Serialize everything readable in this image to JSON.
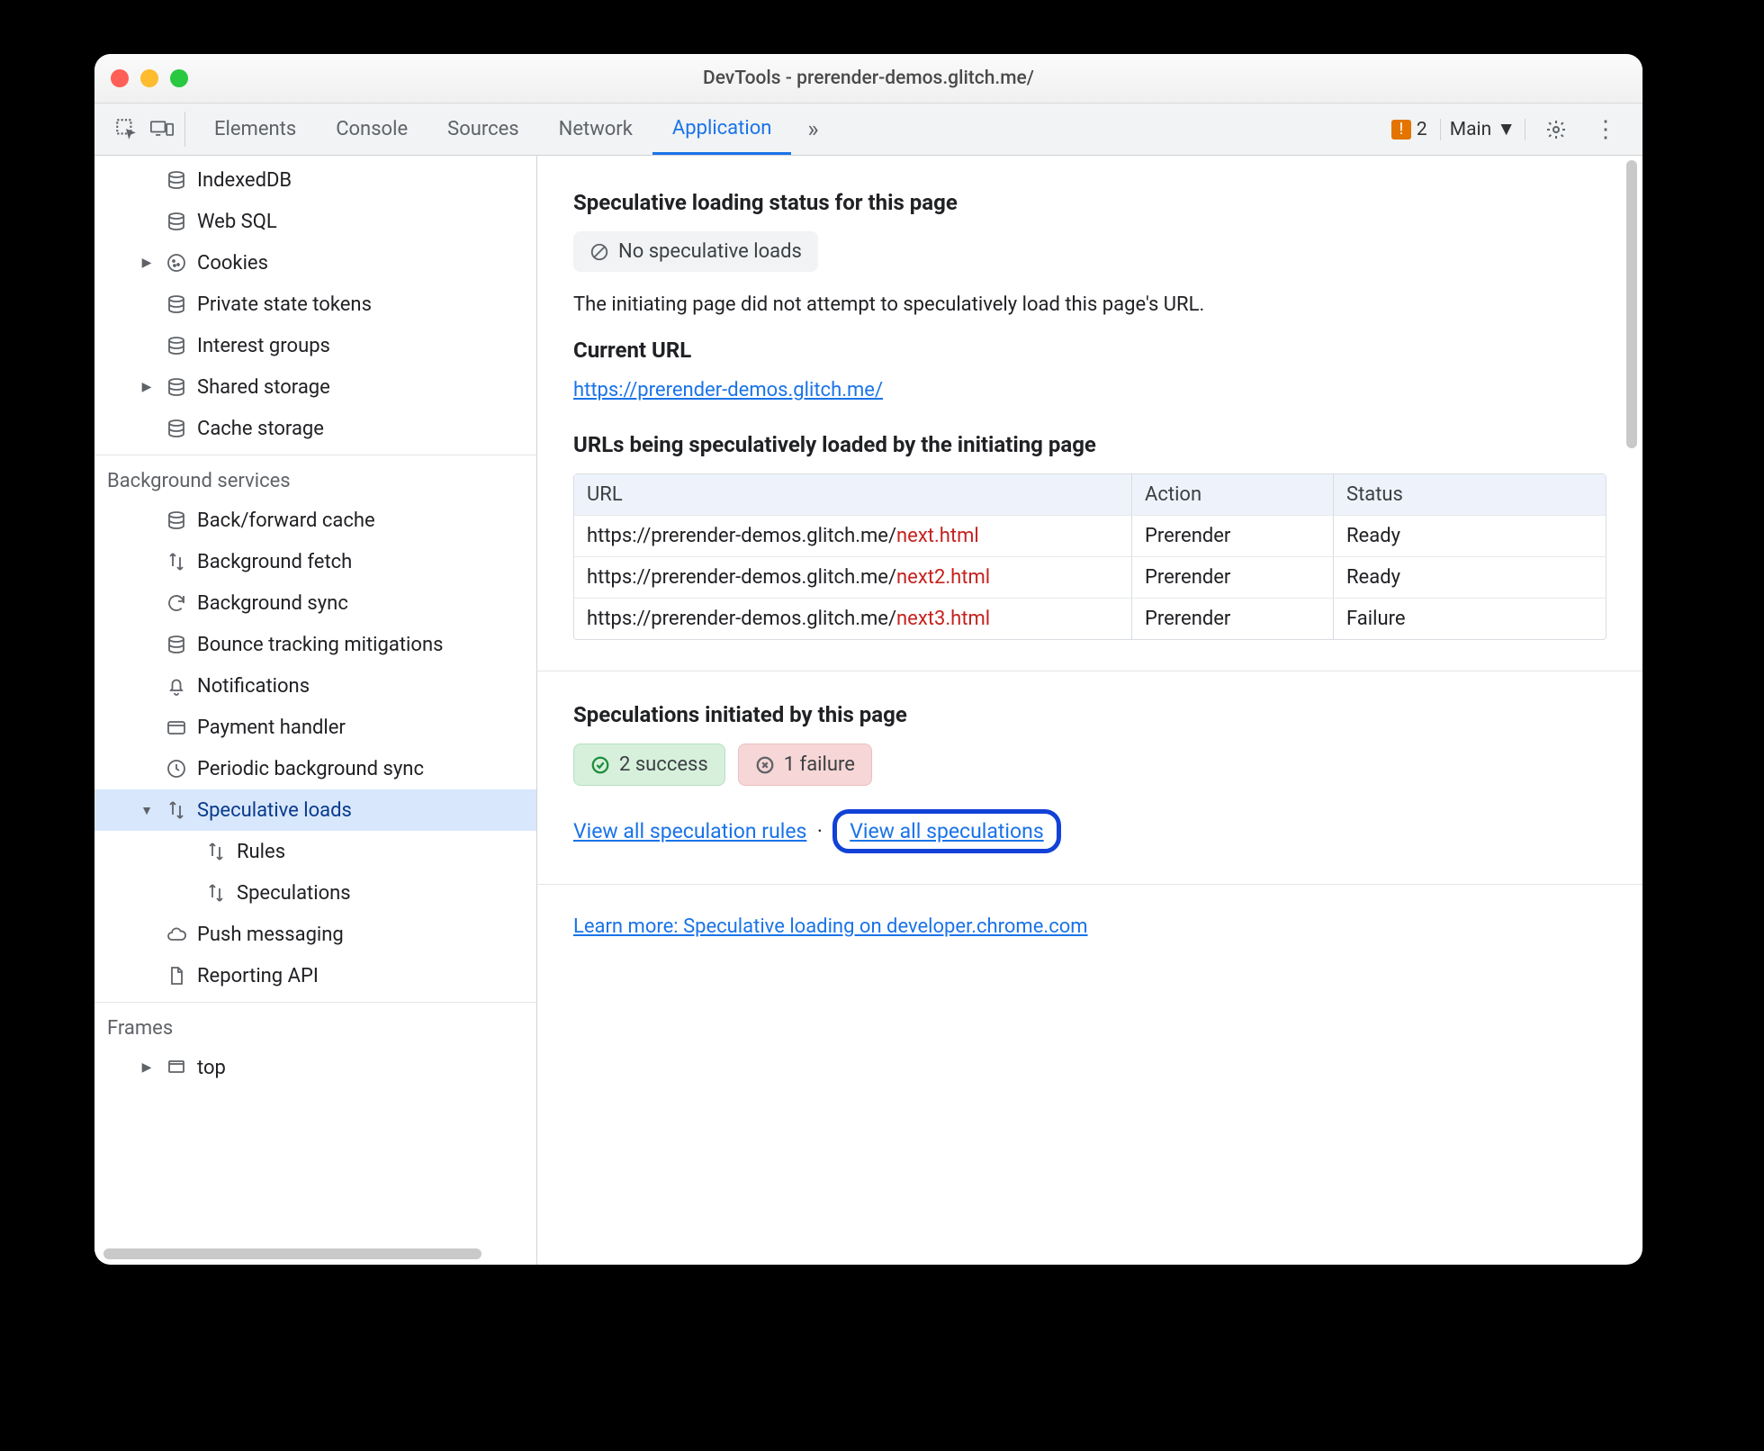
{
  "window_title": "DevTools - prerender-demos.glitch.me/",
  "toolbar": {
    "tabs": [
      "Elements",
      "Console",
      "Sources",
      "Network",
      "Application"
    ],
    "active": "Application",
    "warning_count": "2",
    "frame_label": "Main"
  },
  "sidebar": {
    "storage": [
      {
        "label": "IndexedDB",
        "icon": "db"
      },
      {
        "label": "Web SQL",
        "icon": "db"
      },
      {
        "label": "Cookies",
        "icon": "cookie",
        "expandable": true
      },
      {
        "label": "Private state tokens",
        "icon": "db"
      },
      {
        "label": "Interest groups",
        "icon": "db"
      },
      {
        "label": "Shared storage",
        "icon": "db",
        "expandable": true
      },
      {
        "label": "Cache storage",
        "icon": "db"
      }
    ],
    "bg_section": "Background services",
    "bg": [
      {
        "label": "Back/forward cache",
        "icon": "db"
      },
      {
        "label": "Background fetch",
        "icon": "updown"
      },
      {
        "label": "Background sync",
        "icon": "sync"
      },
      {
        "label": "Bounce tracking mitigations",
        "icon": "db"
      },
      {
        "label": "Notifications",
        "icon": "bell"
      },
      {
        "label": "Payment handler",
        "icon": "card"
      },
      {
        "label": "Periodic background sync",
        "icon": "clock"
      },
      {
        "label": "Speculative loads",
        "icon": "updown",
        "expanded": true,
        "selected": true,
        "children": [
          {
            "label": "Rules",
            "icon": "updown"
          },
          {
            "label": "Speculations",
            "icon": "updown"
          }
        ]
      },
      {
        "label": "Push messaging",
        "icon": "cloud"
      },
      {
        "label": "Reporting API",
        "icon": "doc"
      }
    ],
    "frames_section": "Frames",
    "frames": [
      {
        "label": "top",
        "icon": "frame",
        "expandable": true
      }
    ]
  },
  "main": {
    "h_status": "Speculative loading status for this page",
    "chip_noloads": "No speculative loads",
    "desc": "The initiating page did not attempt to speculatively load this page's URL.",
    "h_url": "Current URL",
    "current_url": "https://prerender-demos.glitch.me/",
    "h_urls": "URLs being speculatively loaded by the initiating page",
    "table": {
      "headers": [
        "URL",
        "Action",
        "Status"
      ],
      "rows": [
        {
          "base": "https://prerender-demos.glitch.me/",
          "file": "next.html",
          "action": "Prerender",
          "status": "Ready"
        },
        {
          "base": "https://prerender-demos.glitch.me/",
          "file": "next2.html",
          "action": "Prerender",
          "status": "Ready"
        },
        {
          "base": "https://prerender-demos.glitch.me/",
          "file": "next3.html",
          "action": "Prerender",
          "status": "Failure"
        }
      ]
    },
    "h_spec": "Speculations initiated by this page",
    "success_chip": "2 success",
    "failure_chip": "1 failure",
    "link_rules": "View all speculation rules",
    "link_specs": "View all speculations",
    "learn_more": "Learn more: Speculative loading on developer.chrome.com"
  }
}
